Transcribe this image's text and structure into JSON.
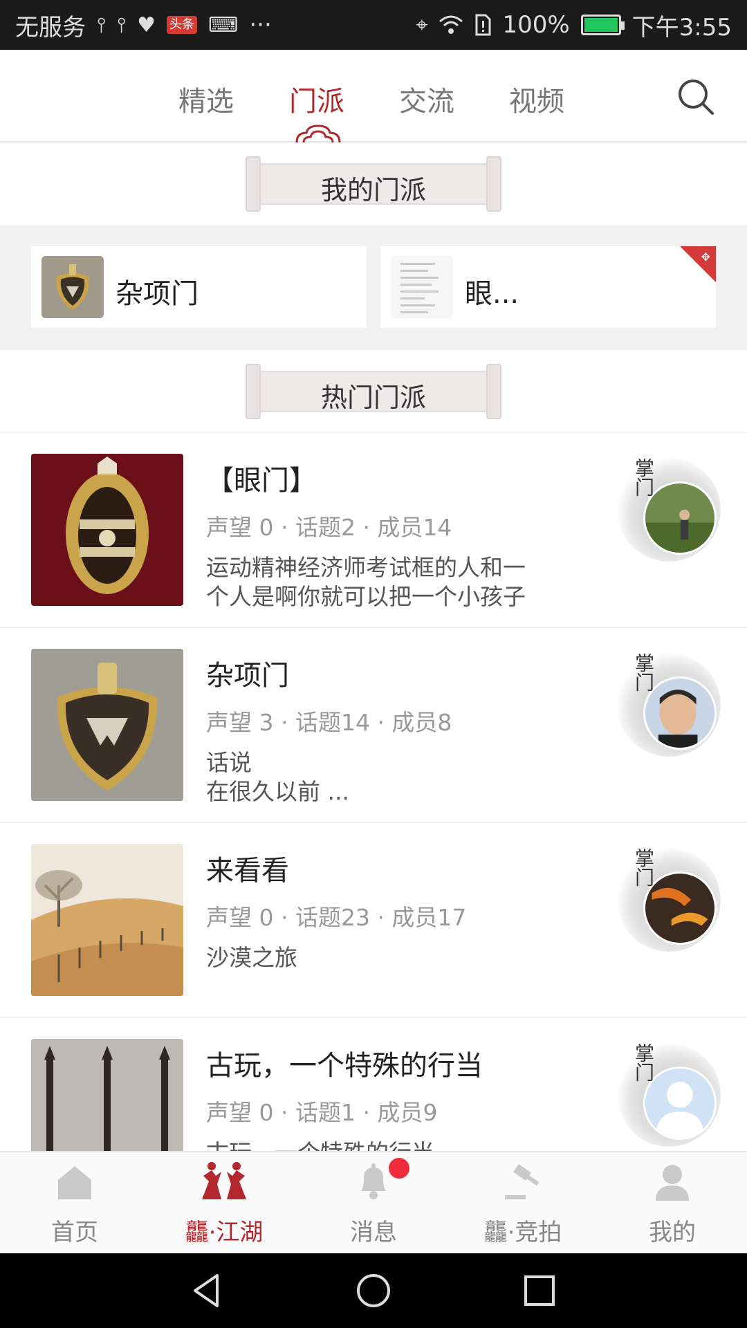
{
  "status_bar": {
    "carrier": "无服务",
    "toutiao_badge": "头条",
    "more": "···",
    "battery": "100%",
    "time": "下午3:55"
  },
  "top_tabs": [
    {
      "label": "精选",
      "active": false
    },
    {
      "label": "门派",
      "active": true
    },
    {
      "label": "交流",
      "active": false
    },
    {
      "label": "视频",
      "active": false
    }
  ],
  "my_sects": {
    "header": "我的门派",
    "items": [
      {
        "name": "杂项门"
      },
      {
        "name": "眼..."
      }
    ]
  },
  "hot_sects": {
    "header": "热门门派",
    "items": [
      {
        "title": "【眼门】",
        "stats": "声望 0 · 话题2 · 成员14",
        "desc": "运动精神经济师考试框的人和一\n个人是啊你就可以把一个小孩子"
      },
      {
        "title": "杂项门",
        "stats": "声望 3 · 话题14 · 成员8",
        "desc": "话说\n在很久以前 ..."
      },
      {
        "title": "来看看",
        "stats": "声望 0 · 话题23 · 成员17",
        "desc": "沙漠之旅"
      },
      {
        "title": "古玩，一个特殊的行当",
        "stats": "声望 0 · 话题1 · 成员9",
        "desc": "古玩，一个特殊的行当"
      }
    ],
    "master_label": "掌门"
  },
  "bottom_tabs": [
    {
      "label": "首页",
      "icon": "home-icon"
    },
    {
      "label": "龘·江湖",
      "icon": "warriors-icon",
      "active": true
    },
    {
      "label": "消息",
      "icon": "bell-icon",
      "badge": true
    },
    {
      "label": "龘·竞拍",
      "icon": "gavel-icon"
    },
    {
      "label": "我的",
      "icon": "person-icon"
    }
  ],
  "colors": {
    "accent": "#b3282d",
    "badge": "#ee2c3c",
    "status_bar": "#1b1b1b"
  }
}
